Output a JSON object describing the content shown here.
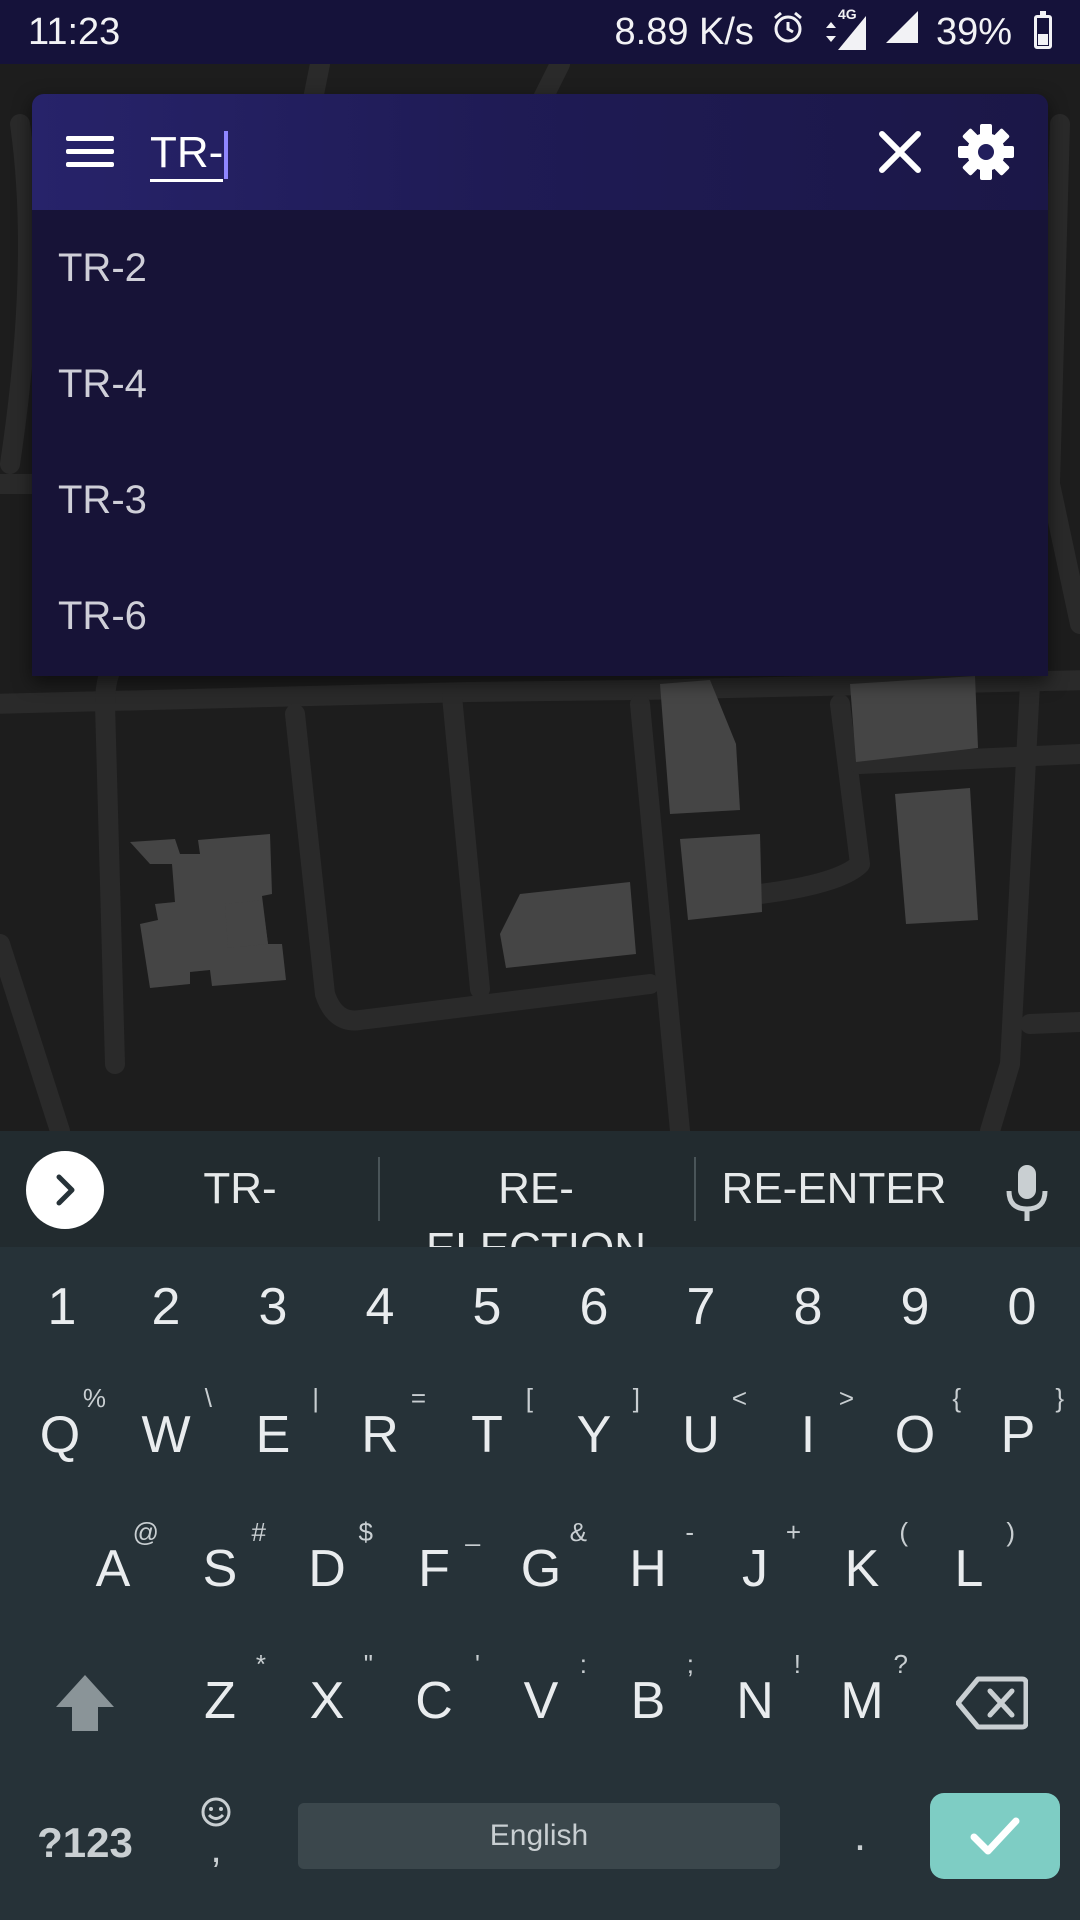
{
  "status_bar": {
    "time": "11:23",
    "net_speed": "8.89 K/s",
    "network": "4G",
    "battery": "39%",
    "battery_level": 0.39,
    "icons": [
      "alarm-icon",
      "data-arrows-icon",
      "signal-icon",
      "signal-icon",
      "battery-icon"
    ]
  },
  "search": {
    "query": "TR-",
    "icons": {
      "menu": "menu-icon",
      "clear": "close-icon",
      "settings": "gear-icon"
    }
  },
  "suggestions": [
    "TR-2",
    "TR-4",
    "TR-3",
    "TR-6"
  ],
  "keyboard": {
    "suggestions": [
      "TR-",
      "RE-ELECTION",
      "RE-ENTER"
    ],
    "number_row": [
      "1",
      "2",
      "3",
      "4",
      "5",
      "6",
      "7",
      "8",
      "9",
      "0"
    ],
    "row1": [
      {
        "key": "Q",
        "hint": "%"
      },
      {
        "key": "W",
        "hint": "\\"
      },
      {
        "key": "E",
        "hint": "|"
      },
      {
        "key": "R",
        "hint": "="
      },
      {
        "key": "T",
        "hint": "["
      },
      {
        "key": "Y",
        "hint": "]"
      },
      {
        "key": "U",
        "hint": "<"
      },
      {
        "key": "I",
        "hint": ">"
      },
      {
        "key": "O",
        "hint": "{"
      },
      {
        "key": "P",
        "hint": "}"
      }
    ],
    "row2": [
      {
        "key": "A",
        "hint": "@"
      },
      {
        "key": "S",
        "hint": "#"
      },
      {
        "key": "D",
        "hint": "$"
      },
      {
        "key": "F",
        "hint": "_"
      },
      {
        "key": "G",
        "hint": "&"
      },
      {
        "key": "H",
        "hint": "-"
      },
      {
        "key": "J",
        "hint": "+"
      },
      {
        "key": "K",
        "hint": "("
      },
      {
        "key": "L",
        "hint": ")"
      }
    ],
    "row3": [
      {
        "key": "Z",
        "hint": "*"
      },
      {
        "key": "X",
        "hint": "\""
      },
      {
        "key": "C",
        "hint": "'"
      },
      {
        "key": "V",
        "hint": ":"
      },
      {
        "key": "B",
        "hint": ";"
      },
      {
        "key": "N",
        "hint": "!"
      },
      {
        "key": "M",
        "hint": "?"
      }
    ],
    "symbols_label": "?123",
    "emoji_comma": ",",
    "space_label": "English",
    "period": "."
  },
  "colors": {
    "status_bar": "#15123a",
    "search_header": "#27236a",
    "suggestion_panel": "#171337",
    "keyboard_bg": "#263238",
    "enter_key": "#7ecdc4"
  }
}
